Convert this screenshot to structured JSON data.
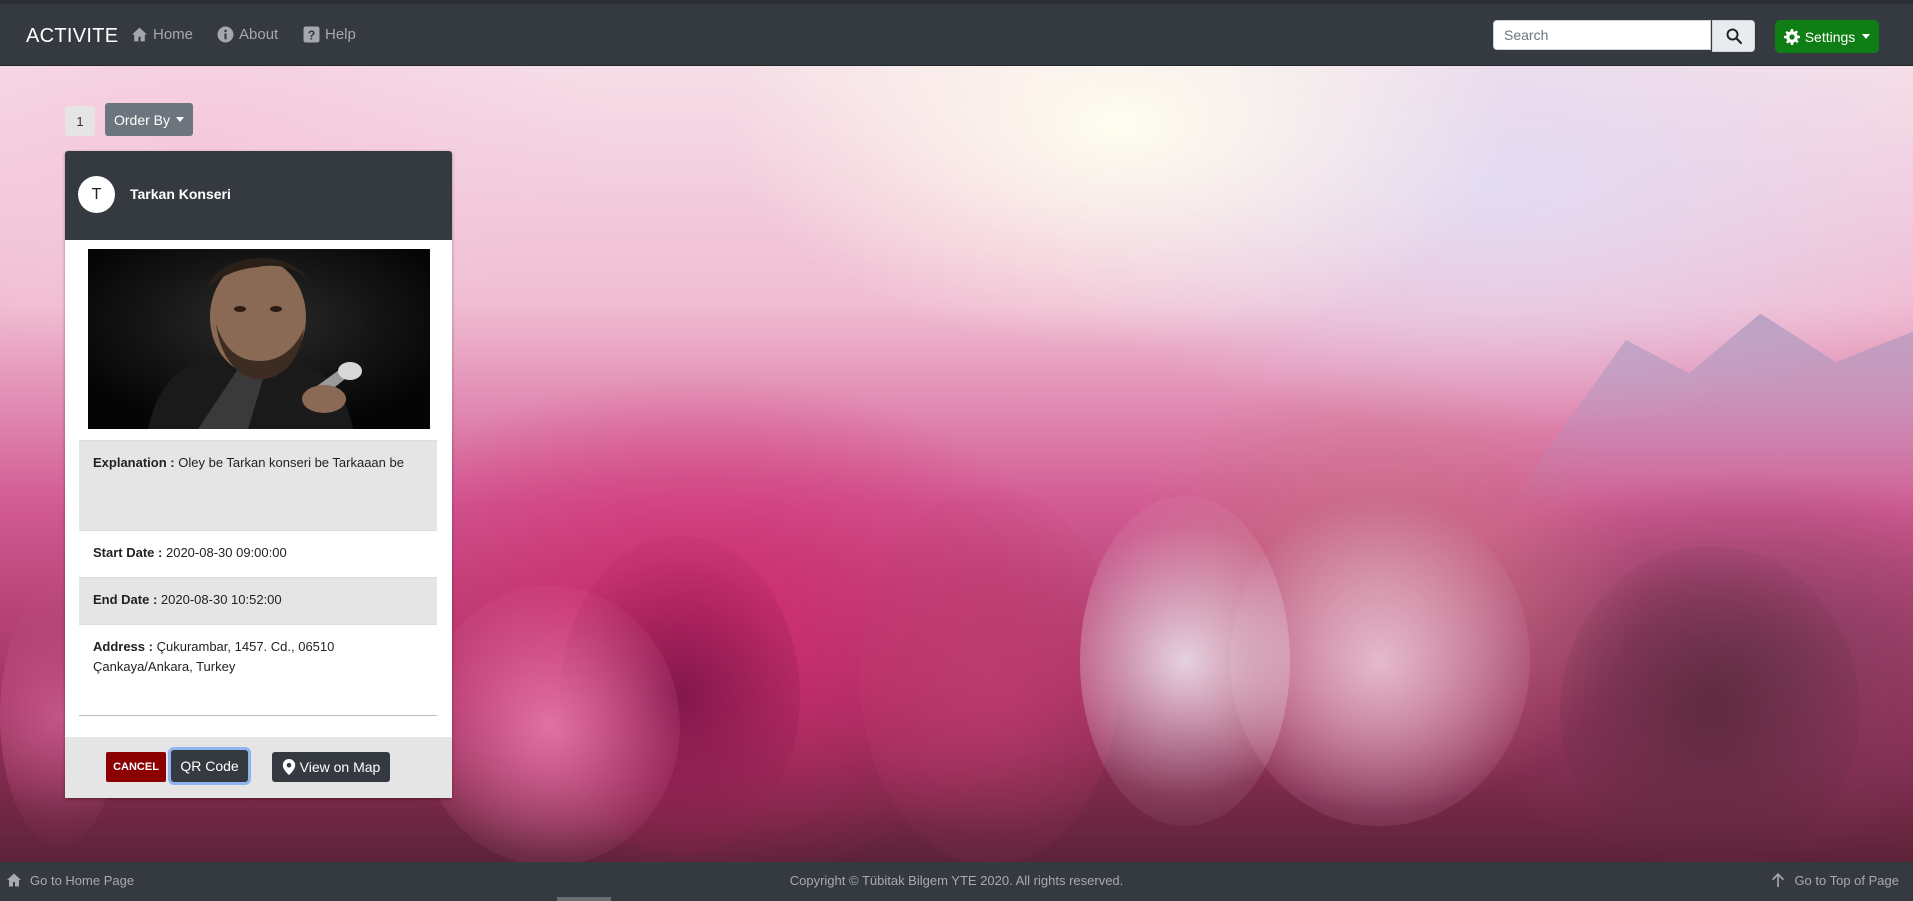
{
  "navbar": {
    "brand": "ACTIVITE",
    "links": [
      {
        "label": "Home",
        "icon": "home-icon"
      },
      {
        "label": "About",
        "icon": "info-icon"
      },
      {
        "label": "Help",
        "icon": "question-icon"
      }
    ],
    "search": {
      "placeholder": "Search",
      "value": ""
    },
    "settings_label": "Settings"
  },
  "toolbar": {
    "page": "1",
    "order_by_label": "Order By"
  },
  "event": {
    "avatar_letter": "T",
    "title": "Tarkan Konseri",
    "explanation_label": "Explanation :",
    "explanation": "Oley be Tarkan konseri be Tarkaaan be",
    "start_label": "Start Date :",
    "start_date": "2020-08-30 09:00:00",
    "end_label": "End Date :",
    "end_date": "2020-08-30 10:52:00",
    "address_label": "Address :",
    "address": "Çukurambar, 1457. Cd., 06510 Çankaya/Ankara, Turkey",
    "cancel_label": "CANCEL",
    "qr_label": "QR Code",
    "map_label": "View on Map"
  },
  "footer": {
    "home_link": "Go to Home Page",
    "copyright": "Copyright © Tübitak Bilgem YTE 2020. All rights reserved.",
    "top_link": "Go to Top of Page"
  },
  "colors": {
    "navbar": "#343a40",
    "settings": "#0f7e15",
    "cancel": "#8b0000",
    "order_by": "#6c757d"
  }
}
